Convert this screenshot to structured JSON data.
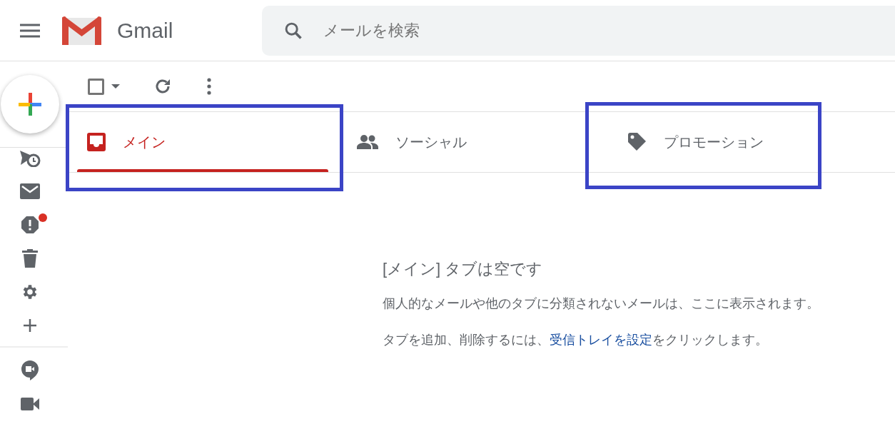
{
  "header": {
    "app_name": "Gmail",
    "search": {
      "placeholder": "メールを検索"
    }
  },
  "sidebar": {
    "items": [
      {
        "kind": "scheduled"
      },
      {
        "kind": "mail"
      },
      {
        "kind": "spam",
        "badge": true
      },
      {
        "kind": "trash"
      },
      {
        "kind": "settings"
      },
      {
        "kind": "add"
      },
      {
        "kind": "divider"
      },
      {
        "kind": "chat"
      },
      {
        "kind": "video"
      }
    ]
  },
  "toolbar": {
    "select_all_checked": false
  },
  "tabs": [
    {
      "label": "メイン",
      "kind": "inbox",
      "selected": true,
      "highlighted": true
    },
    {
      "label": "ソーシャル",
      "kind": "people",
      "selected": false,
      "highlighted": false
    },
    {
      "label": "プロモーション",
      "kind": "tag",
      "selected": false,
      "highlighted": true
    }
  ],
  "empty_state": {
    "title": "[メイン] タブは空です",
    "description": "個人的なメールや他のタブに分類されないメールは、ここに表示されます。",
    "hint_before": "タブを追加、削除するには、",
    "hint_link": "受信トレイを設定",
    "hint_after": "をクリックします。"
  }
}
